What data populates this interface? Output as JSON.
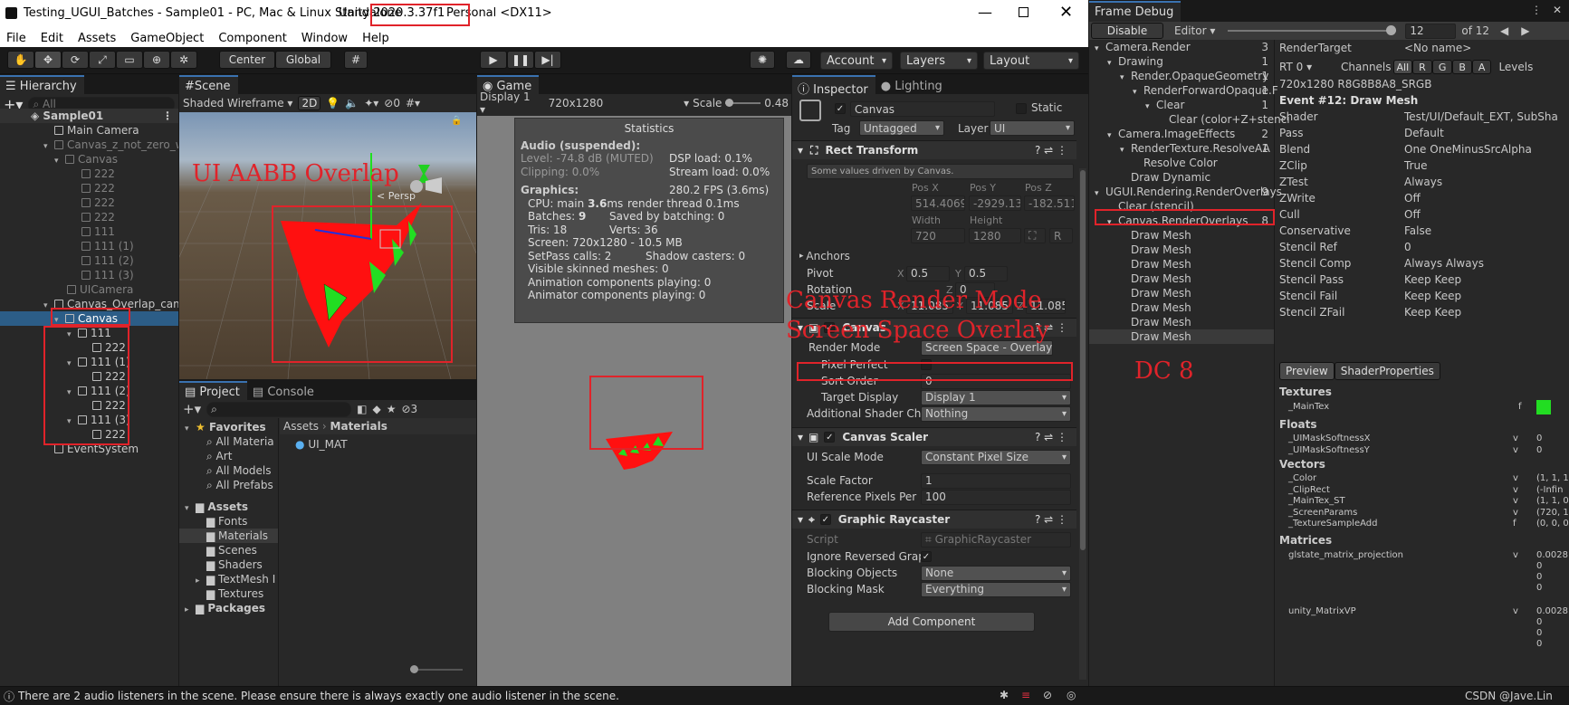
{
  "window": {
    "title_prefix": "Testing_UGUI_Batches - Sample01 - PC, Mac & Linux Standalone",
    "unity_version": "Unity 2020.3.37f1",
    "title_suffix": "Personal <DX11>"
  },
  "menu": [
    "File",
    "Edit",
    "Assets",
    "GameObject",
    "Component",
    "Window",
    "Help"
  ],
  "toolbar": {
    "center": "Center",
    "global": "Global",
    "account": "Account",
    "layers": "Layers",
    "layout": "Layout"
  },
  "hierarchy": {
    "tab": "Hierarchy",
    "search_placeholder": "All",
    "scene": "Sample01",
    "items": [
      "Main Camera",
      "Canvas_z_not_zero_w",
      "Canvas",
      "222",
      "222",
      "222",
      "222",
      "111",
      "111 (1)",
      "111 (2)",
      "111 (3)",
      "UICamera",
      "Canvas_Overlap_cam",
      "Canvas",
      "111",
      "222",
      "111 (1)",
      "222",
      "111 (2)",
      "222",
      "111 (3)",
      "222",
      "EventSystem"
    ]
  },
  "scene": {
    "tab": "Scene",
    "shading": "Shaded Wireframe",
    "mode": "2D",
    "persp": "< Persp",
    "hidden_count": "0",
    "annotation": "UI AABB Overlap"
  },
  "game": {
    "tab": "Game",
    "display": "Display 1",
    "resolution": "720x1280",
    "scale_label": "Scale",
    "scale_value": "0.48"
  },
  "stats": {
    "title": "Statistics",
    "audio_head": "Audio (suspended):",
    "level": "Level: -74.8 dB (MUTED)",
    "dsp": "DSP load: 0.1%",
    "clipping": "Clipping: 0.0%",
    "stream": "Stream load: 0.0%",
    "graphics_head": "Graphics:",
    "fps": "280.2 FPS (3.6ms)",
    "cpu_label": "CPU: main ",
    "cpu_main": "3.6",
    "cpu_unit": "ms",
    "render_thread": "render thread 0.1ms",
    "batches_label": "Batches: ",
    "batches": "9",
    "saved": "Saved by batching: 0",
    "tris": "Tris: 18",
    "verts": "Verts: 36",
    "screen": "Screen: 720x1280 - 10.5 MB",
    "setpass": "SetPass calls: 2",
    "shadow": "Shadow casters: 0",
    "skinned": "Visible skinned meshes: 0",
    "anim": "Animation components playing: 0",
    "animator": "Animator components playing: 0"
  },
  "project": {
    "tab": "Project",
    "console_tab": "Console",
    "badge": "3",
    "favorites": "Favorites",
    "fav_items": [
      "All Materia",
      "Art",
      "All Models",
      "All Prefabs"
    ],
    "assets": "Assets",
    "asset_items": [
      "Fonts",
      "Materials",
      "Scenes",
      "Shaders",
      "TextMesh I",
      "Textures"
    ],
    "packages": "Packages",
    "breadcrumb_root": "Assets",
    "breadcrumb_leaf": "Materials",
    "file": "UI_MAT"
  },
  "inspector": {
    "tab": "Inspector",
    "lighting_tab": "Lighting",
    "object_name": "Canvas",
    "static": "Static",
    "tag_label": "Tag",
    "tag": "Untagged",
    "layer_label": "Layer",
    "layer": "UI",
    "rect": {
      "title": "Rect Transform",
      "note": "Some values driven by Canvas.",
      "posx_l": "Pos X",
      "posy_l": "Pos Y",
      "posz_l": "Pos Z",
      "posx": "514.4069",
      "posy": "-2929.13",
      "posz": "-182.5118",
      "w_l": "Width",
      "h_l": "Height",
      "w": "720",
      "h": "1280",
      "r": "R",
      "anchors": "Anchors",
      "pivot": "Pivot",
      "px": "0.5",
      "py": "0.5",
      "rotation": "Rotation",
      "rz": "0",
      "scale": "Scale",
      "sx": "11.085",
      "sy": "11.085",
      "sz": "11.085",
      "x": "X",
      "y": "Y",
      "z": "Z"
    },
    "canvas": {
      "title": "Canvas",
      "render_mode_l": "Render Mode",
      "render_mode": "Screen Space - Overlay",
      "pixel_perfect_l": "Pixel Perfect",
      "sort_order_l": "Sort Order",
      "sort_order": "0",
      "target_display_l": "Target Display",
      "target_display": "Display 1",
      "add_shader_l": "Additional Shader Ch",
      "add_shader": "Nothing"
    },
    "scaler": {
      "title": "Canvas Scaler",
      "mode_l": "UI Scale Mode",
      "mode": "Constant Pixel Size",
      "factor_l": "Scale Factor",
      "factor": "1",
      "ref_l": "Reference Pixels Per",
      "ref": "100"
    },
    "raycaster": {
      "title": "Graphic Raycaster",
      "script_l": "Script",
      "script": "GraphicRaycaster",
      "ignore_l": "Ignore Reversed Grap",
      "blocking_l": "Blocking Objects",
      "blocking": "None",
      "mask_l": "Blocking Mask",
      "mask": "Everything"
    },
    "add_component": "Add Component",
    "annotation1": "Canvas Render Mode",
    "annotation2": "Screen Space Overlay"
  },
  "frame_debug": {
    "title": "Frame Debug",
    "disable": "Disable",
    "editor": "Editor",
    "current": "12",
    "total": "of 12",
    "tree": [
      {
        "t": "Camera.Render",
        "n": "3",
        "d": 0,
        "a": "▾"
      },
      {
        "t": "Drawing",
        "n": "1",
        "d": 1,
        "a": "▾"
      },
      {
        "t": "Render.OpaqueGeometry",
        "n": "1",
        "d": 2,
        "a": "▾"
      },
      {
        "t": "RenderForwardOpaque.F",
        "n": "1",
        "d": 3,
        "a": "▾"
      },
      {
        "t": "Clear",
        "n": "1",
        "d": 4,
        "a": "▾"
      },
      {
        "t": "Clear (color+Z+stenci",
        "n": "",
        "d": 5,
        "a": ""
      },
      {
        "t": "Camera.ImageEffects",
        "n": "2",
        "d": 1,
        "a": "▾"
      },
      {
        "t": "RenderTexture.ResolveAA",
        "n": "1",
        "d": 2,
        "a": "▾"
      },
      {
        "t": "Resolve Color",
        "n": "",
        "d": 3,
        "a": ""
      },
      {
        "t": "Draw Dynamic",
        "n": "",
        "d": 2,
        "a": ""
      },
      {
        "t": "UGUI.Rendering.RenderOverlays",
        "n": "9",
        "d": 0,
        "a": "▾"
      },
      {
        "t": "Clear (stencil)",
        "n": "",
        "d": 1,
        "a": ""
      },
      {
        "t": "Canvas.RenderOverlays",
        "n": "8",
        "d": 1,
        "a": "▾"
      },
      {
        "t": "Draw Mesh",
        "n": "",
        "d": 2,
        "a": ""
      },
      {
        "t": "Draw Mesh",
        "n": "",
        "d": 2,
        "a": ""
      },
      {
        "t": "Draw Mesh",
        "n": "",
        "d": 2,
        "a": ""
      },
      {
        "t": "Draw Mesh",
        "n": "",
        "d": 2,
        "a": ""
      },
      {
        "t": "Draw Mesh",
        "n": "",
        "d": 2,
        "a": ""
      },
      {
        "t": "Draw Mesh",
        "n": "",
        "d": 2,
        "a": ""
      },
      {
        "t": "Draw Mesh",
        "n": "",
        "d": 2,
        "a": ""
      },
      {
        "t": "Draw Mesh",
        "n": "",
        "d": 2,
        "a": ""
      }
    ],
    "dc_annotation": "DC 8",
    "render_target_l": "RenderTarget",
    "render_target": "<No name>",
    "rt": "RT 0",
    "channels": "Channels",
    "ch": [
      "All",
      "R",
      "G",
      "B",
      "A"
    ],
    "levels": "Levels",
    "format": "720x1280 R8G8B8A8_SRGB",
    "event": "Event #12: Draw Mesh",
    "props": [
      [
        "Shader",
        "Test/UI/Default_EXT, SubSha"
      ],
      [
        "Pass",
        "Default"
      ],
      [
        "Blend",
        "One OneMinusSrcAlpha"
      ],
      [
        "ZClip",
        "True"
      ],
      [
        "ZTest",
        "Always"
      ],
      [
        "ZWrite",
        "Off"
      ],
      [
        "Cull",
        "Off"
      ],
      [
        "Conservative",
        "False"
      ],
      [
        "Stencil Ref",
        "0"
      ],
      [
        "Stencil Comp",
        "Always Always"
      ],
      [
        "Stencil Pass",
        "Keep Keep"
      ],
      [
        "Stencil Fail",
        "Keep Keep"
      ],
      [
        "Stencil ZFail",
        "Keep Keep"
      ]
    ],
    "preview_tab": "Preview",
    "shader_tab": "ShaderProperties",
    "textures": "Textures",
    "tex_name": "_MainTex",
    "tex_flag": "f",
    "floats": "Floats",
    "float_items": [
      [
        "_UIMaskSoftnessX",
        "v",
        "0"
      ],
      [
        "_UIMaskSoftnessY",
        "v",
        "0"
      ]
    ],
    "vectors": "Vectors",
    "vector_items": [
      [
        "_Color",
        "v",
        "(1, 1, 1"
      ],
      [
        "_ClipRect",
        "v",
        "(-Infin"
      ],
      [
        "_MainTex_ST",
        "v",
        "(1, 1, 0"
      ],
      [
        "_ScreenParams",
        "v",
        "(720, 1"
      ],
      [
        "_TextureSampleAdd",
        "f",
        "(0, 0, 0"
      ]
    ],
    "matrices": "Matrices",
    "mat1": "glstate_matrix_projection",
    "mat1_v": [
      "0.0028",
      "0",
      "0",
      "0"
    ],
    "mat2": "unity_MatrixVP",
    "mat2_v": [
      "0.0028",
      "0",
      "0",
      "0"
    ],
    "mat_flag": "v"
  },
  "status": {
    "message": "There are 2 audio listeners in the scene. Please ensure there is always exactly one audio listener in the scene.",
    "watermark": "CSDN @Jave.Lin"
  },
  "colors": {
    "accent": "#2c5d87",
    "annotation": "#e0232a",
    "mesh_red": "#ff1010",
    "mesh_green": "#22dd22"
  }
}
